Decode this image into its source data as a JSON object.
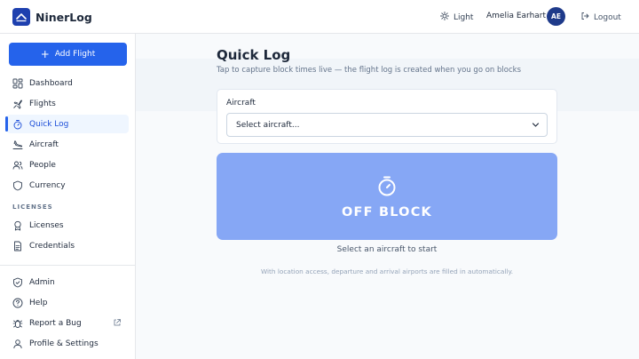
{
  "app": {
    "name": "NinerLog"
  },
  "header": {
    "theme_label": "Light",
    "user_name": "Amelia Earhart",
    "user_initials": "AE",
    "logout_label": "Logout"
  },
  "sidebar": {
    "add_flight_label": "Add Flight",
    "items": [
      {
        "label": "Dashboard",
        "icon": "dashboard-icon"
      },
      {
        "label": "Flights",
        "icon": "plane-icon"
      },
      {
        "label": "Quick Log",
        "icon": "stopwatch-icon",
        "active": true
      },
      {
        "label": "Aircraft",
        "icon": "plane-landing-icon"
      },
      {
        "label": "People",
        "icon": "people-icon"
      },
      {
        "label": "Currency",
        "icon": "shield-icon"
      }
    ],
    "licenses_section_label": "LICENSES",
    "license_items": [
      {
        "label": "Licenses",
        "icon": "award-icon"
      },
      {
        "label": "Credentials",
        "icon": "document-icon"
      }
    ],
    "bottom_items": [
      {
        "label": "Admin",
        "icon": "shield-check-icon"
      },
      {
        "label": "Help",
        "icon": "help-icon"
      },
      {
        "label": "Report a Bug",
        "icon": "bug-icon",
        "external": true
      },
      {
        "label": "Profile & Settings",
        "icon": "user-icon"
      }
    ]
  },
  "main": {
    "title": "Quick Log",
    "subtitle": "Tap to capture block times live — the flight log is created when you go on blocks",
    "aircraft_label": "Aircraft",
    "aircraft_select_value": "Select aircraft...",
    "off_block_label": "OFF BLOCK",
    "hint": "Select an aircraft to start",
    "footnote": "With location access, departure and arrival airports are filled in automatically."
  },
  "colors": {
    "primary": "#2563eb",
    "brand_dark": "#1e40af",
    "off_block_bg": "#86a7f5",
    "avatar_bg": "#1e3a8a"
  }
}
